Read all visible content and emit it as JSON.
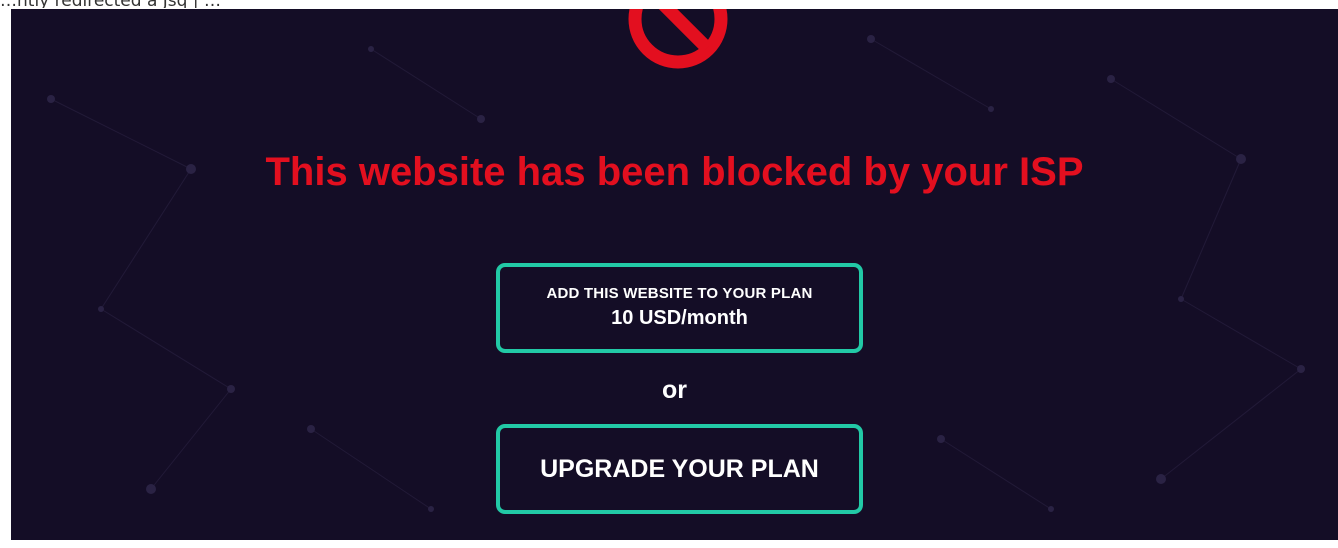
{
  "caption": {
    "partial_text": "…ntly redirected a Jsq | …"
  },
  "block_notice": {
    "icon": "prohibited-icon",
    "headline": "This website has been blocked by your ISP"
  },
  "offer": {
    "add_button": {
      "line1": "ADD THIS WEBSITE TO YOUR PLAN",
      "line2": "10 USD/month"
    },
    "or_label": "or",
    "upgrade_button": {
      "label": "UPGRADE YOUR PLAN"
    }
  },
  "colors": {
    "background": "#140d26",
    "headline": "#e30f1f",
    "button_border": "#22c9a6",
    "icon": "#e30f1f"
  }
}
